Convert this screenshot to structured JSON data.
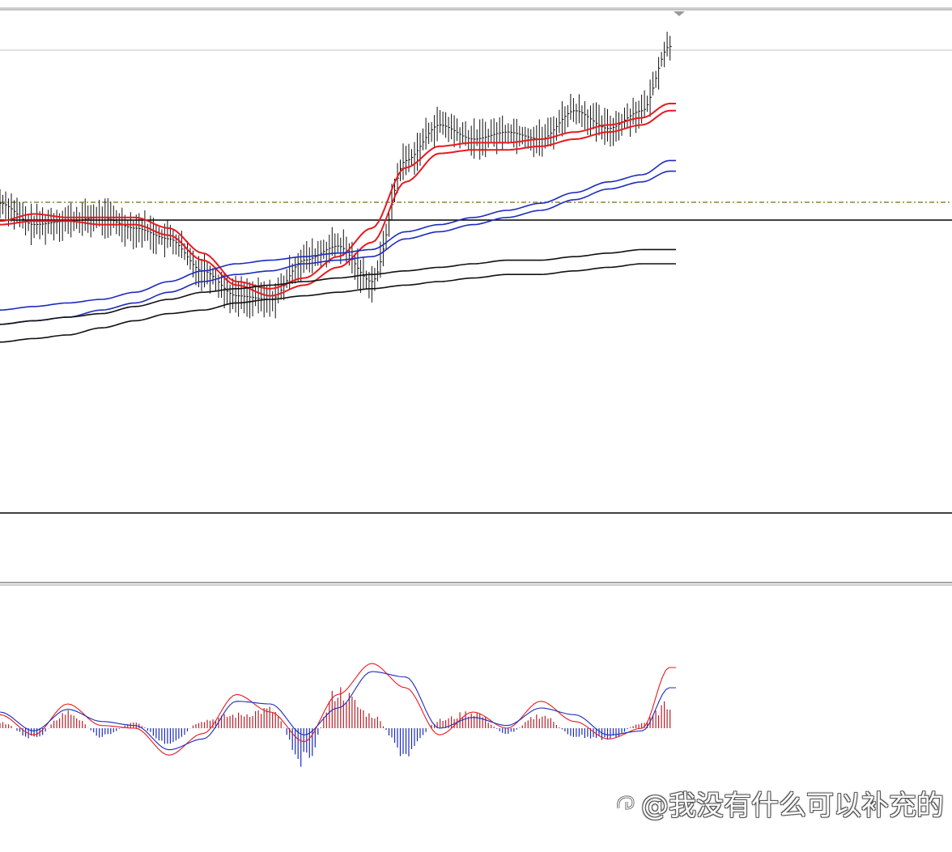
{
  "watermark": {
    "logo_icon": "toutiao-logo-icon",
    "text": "@我没有什么可以补充的"
  },
  "colors": {
    "price_bar": "#111111",
    "ma_fast": "#e8191f",
    "ma_mid": "#1c2bbd",
    "ma_slow": "#111111",
    "macd_pos": "#b5202a",
    "macd_neg": "#1c2bbd",
    "signal_line": "#e8191f",
    "macd_line": "#1c2bbd",
    "dashed_level": "#7a6a10",
    "panel_line": "#000000"
  },
  "chart_data": [
    {
      "type": "line",
      "panel": "price",
      "title": "",
      "xlabel": "",
      "ylabel": "",
      "grid": false,
      "ylim": [
        0,
        100
      ],
      "x_range": [
        0,
        100
      ],
      "price_bars": {
        "x": [
          0,
          5,
          10,
          15,
          20,
          25,
          30,
          35,
          40,
          45,
          50,
          55,
          60,
          65,
          70,
          75,
          80,
          85,
          90,
          95,
          99
        ],
        "close": [
          52,
          46,
          47,
          48,
          45,
          42,
          33,
          26,
          25,
          36,
          40,
          30,
          64,
          74,
          70,
          72,
          70,
          78,
          73,
          78,
          96
        ]
      },
      "series": [
        {
          "key": "ma_fast_1",
          "x": [
            0,
            5,
            10,
            15,
            20,
            25,
            30,
            35,
            40,
            45,
            50,
            55,
            60,
            65,
            70,
            75,
            80,
            85,
            90,
            95,
            99
          ],
          "values": [
            47,
            49,
            48,
            48,
            48,
            45,
            38,
            30,
            28,
            31,
            37,
            45,
            62,
            68,
            69,
            69,
            70,
            72,
            74,
            76,
            80
          ]
        },
        {
          "key": "ma_fast_2",
          "x": [
            0,
            5,
            10,
            15,
            20,
            25,
            30,
            35,
            40,
            45,
            50,
            55,
            60,
            65,
            70,
            75,
            80,
            85,
            90,
            95,
            99
          ],
          "values": [
            46,
            47,
            47,
            46,
            46,
            43,
            36,
            29,
            26,
            29,
            34,
            41,
            58,
            66,
            67,
            67,
            68,
            70,
            72,
            74,
            78
          ]
        },
        {
          "key": "ma_mid_1",
          "x": [
            0,
            5,
            10,
            15,
            20,
            25,
            30,
            35,
            40,
            45,
            50,
            55,
            60,
            65,
            70,
            75,
            80,
            85,
            90,
            95,
            99
          ],
          "values": [
            22,
            23,
            24,
            25,
            27,
            30,
            33,
            35,
            36,
            37,
            38,
            39,
            44,
            46,
            48,
            50,
            52,
            55,
            58,
            60,
            64
          ]
        },
        {
          "key": "ma_mid_2",
          "x": [
            0,
            5,
            10,
            15,
            20,
            25,
            30,
            35,
            40,
            45,
            50,
            55,
            60,
            65,
            70,
            75,
            80,
            85,
            90,
            95,
            99
          ],
          "values": [
            18,
            19,
            20,
            22,
            24,
            27,
            30,
            32,
            33,
            35,
            36,
            37,
            42,
            44,
            46,
            48,
            50,
            53,
            56,
            58,
            61
          ]
        },
        {
          "key": "ma_slow_1",
          "x": [
            0,
            5,
            10,
            15,
            20,
            25,
            30,
            35,
            40,
            45,
            50,
            55,
            60,
            65,
            70,
            75,
            80,
            85,
            90,
            95,
            99
          ],
          "values": [
            18,
            19,
            20,
            21,
            23,
            25,
            27,
            28,
            29,
            30,
            31,
            32,
            33,
            34,
            35,
            36,
            36,
            37,
            38,
            39,
            39
          ]
        },
        {
          "key": "ma_slow_2",
          "x": [
            0,
            5,
            10,
            15,
            20,
            25,
            30,
            35,
            40,
            45,
            50,
            55,
            60,
            65,
            70,
            75,
            80,
            85,
            90,
            95,
            99
          ],
          "values": [
            13,
            14,
            15,
            17,
            19,
            21,
            22,
            24,
            25,
            26,
            27,
            28,
            29,
            30,
            31,
            32,
            32,
            33,
            34,
            35,
            35
          ]
        }
      ]
    },
    {
      "type": "bar",
      "panel": "macd",
      "title": "",
      "xlabel": "",
      "ylabel": "",
      "grid": false,
      "ylim": [
        -30,
        60
      ],
      "x": [
        0,
        5,
        10,
        15,
        20,
        25,
        30,
        35,
        40,
        45,
        50,
        55,
        60,
        65,
        70,
        75,
        80,
        85,
        90,
        95,
        99
      ],
      "histogram": [
        5,
        -8,
        12,
        -6,
        4,
        -14,
        6,
        10,
        14,
        -25,
        28,
        10,
        -20,
        6,
        12,
        -4,
        10,
        -6,
        -8,
        4,
        18
      ],
      "series": [
        {
          "key": "signal",
          "x": [
            0,
            5,
            10,
            15,
            20,
            25,
            30,
            35,
            40,
            45,
            50,
            55,
            60,
            65,
            70,
            75,
            80,
            85,
            90,
            95,
            99
          ],
          "values": [
            10,
            -5,
            18,
            2,
            0,
            -20,
            -4,
            25,
            12,
            -10,
            25,
            48,
            30,
            -5,
            12,
            0,
            20,
            5,
            -8,
            0,
            45
          ]
        },
        {
          "key": "macd",
          "x": [
            0,
            5,
            10,
            15,
            20,
            25,
            30,
            35,
            40,
            45,
            50,
            55,
            60,
            65,
            70,
            75,
            80,
            85,
            90,
            95,
            99
          ],
          "values": [
            12,
            -2,
            14,
            5,
            2,
            -16,
            -8,
            20,
            18,
            -5,
            15,
            42,
            38,
            0,
            8,
            2,
            15,
            10,
            -5,
            -2,
            30
          ]
        }
      ]
    }
  ]
}
